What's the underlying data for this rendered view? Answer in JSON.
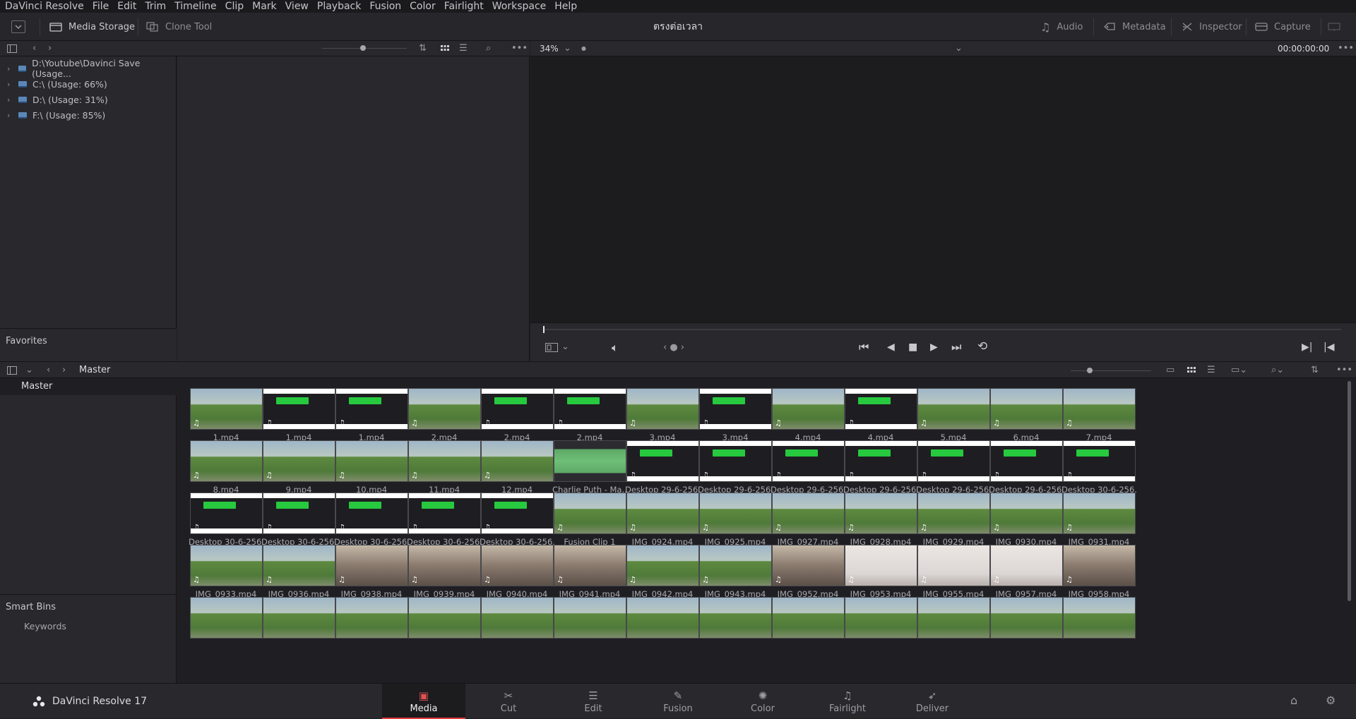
{
  "menu": [
    "DaVinci Resolve",
    "File",
    "Edit",
    "Trim",
    "Timeline",
    "Clip",
    "Mark",
    "View",
    "Playback",
    "Fusion",
    "Color",
    "Fairlight",
    "Workspace",
    "Help"
  ],
  "toolbar": {
    "media_storage": "Media Storage",
    "clone_tool": "Clone Tool",
    "title": "ตรงต่อเวลา",
    "audio": "Audio",
    "metadata": "Metadata",
    "inspector": "Inspector",
    "capture": "Capture"
  },
  "viewer": {
    "zoom": "34%",
    "timecode": "00:00:00:00"
  },
  "storage": {
    "drives": [
      "D:\\Youtube\\Davinci Save (Usage...",
      "C:\\ (Usage: 66%)",
      "D:\\ (Usage: 31%)",
      "F:\\ (Usage: 85%)"
    ],
    "favorites": "Favorites"
  },
  "pool": {
    "breadcrumb": "Master",
    "master": "Master",
    "smart_bins": "Smart Bins",
    "keywords": "Keywords",
    "clips": [
      {
        "name": "1.mp4",
        "kind": "outdoor"
      },
      {
        "name": "1.mp4",
        "kind": "screen"
      },
      {
        "name": "1.mp4",
        "kind": "screen"
      },
      {
        "name": "2.mp4",
        "kind": "outdoor"
      },
      {
        "name": "2.mp4",
        "kind": "screen"
      },
      {
        "name": "2.mp4",
        "kind": "screen"
      },
      {
        "name": "3.mp4",
        "kind": "outdoor"
      },
      {
        "name": "3.mp4",
        "kind": "screen"
      },
      {
        "name": "4.mp4",
        "kind": "outdoor"
      },
      {
        "name": "4.mp4",
        "kind": "screen"
      },
      {
        "name": "5.mp4",
        "kind": "outdoor"
      },
      {
        "name": "6.mp4",
        "kind": "outdoor"
      },
      {
        "name": "7.mp4",
        "kind": "outdoor"
      },
      {
        "name": "8.mp4",
        "kind": "outdoor"
      },
      {
        "name": "9.mp4",
        "kind": "outdoor"
      },
      {
        "name": "10.mp4",
        "kind": "outdoor"
      },
      {
        "name": "11.mp4",
        "kind": "outdoor"
      },
      {
        "name": "12.mp4",
        "kind": "outdoor"
      },
      {
        "name": "Charlie Puth - Ma...",
        "kind": "audio"
      },
      {
        "name": "Desktop 29-6-256...",
        "kind": "screen"
      },
      {
        "name": "Desktop 29-6-256...",
        "kind": "screen"
      },
      {
        "name": "Desktop 29-6-256...",
        "kind": "screen"
      },
      {
        "name": "Desktop 29-6-256...",
        "kind": "screen"
      },
      {
        "name": "Desktop 29-6-256...",
        "kind": "screen"
      },
      {
        "name": "Desktop 29-6-256...",
        "kind": "screen"
      },
      {
        "name": "Desktop 30-6-256...",
        "kind": "screen"
      },
      {
        "name": "Desktop 30-6-256...",
        "kind": "screen"
      },
      {
        "name": "Desktop 30-6-256...",
        "kind": "screen"
      },
      {
        "name": "Desktop 30-6-256...",
        "kind": "screen"
      },
      {
        "name": "Desktop 30-6-256...",
        "kind": "screen"
      },
      {
        "name": "Desktop 30-6-256...",
        "kind": "screen"
      },
      {
        "name": "Fusion Clip 1",
        "kind": "outdoor"
      },
      {
        "name": "IMG_0924.mp4",
        "kind": "outdoor"
      },
      {
        "name": "IMG_0925.mp4",
        "kind": "outdoor"
      },
      {
        "name": "IMG_0927.mp4",
        "kind": "outdoor"
      },
      {
        "name": "IMG_0928.mp4",
        "kind": "outdoor"
      },
      {
        "name": "IMG_0929.mp4",
        "kind": "outdoor"
      },
      {
        "name": "IMG_0930.mp4",
        "kind": "outdoor"
      },
      {
        "name": "IMG_0931.mp4",
        "kind": "outdoor"
      },
      {
        "name": "IMG_0933.mp4",
        "kind": "outdoor"
      },
      {
        "name": "IMG_0936.mp4",
        "kind": "outdoor"
      },
      {
        "name": "IMG_0938.mp4",
        "kind": "indoor"
      },
      {
        "name": "IMG_0939.mp4",
        "kind": "indoor"
      },
      {
        "name": "IMG_0940.mp4",
        "kind": "indoor"
      },
      {
        "name": "IMG_0941.mp4",
        "kind": "indoor"
      },
      {
        "name": "IMG_0942.mp4",
        "kind": "outdoor"
      },
      {
        "name": "IMG_0943.mp4",
        "kind": "outdoor"
      },
      {
        "name": "IMG_0952.mp4",
        "kind": "indoor"
      },
      {
        "name": "IMG_0953.mp4",
        "kind": "wall"
      },
      {
        "name": "IMG_0955.mp4",
        "kind": "wall"
      },
      {
        "name": "IMG_0957.mp4",
        "kind": "wall"
      },
      {
        "name": "IMG_0958.mp4",
        "kind": "indoor"
      }
    ]
  },
  "pages": [
    "Media",
    "Cut",
    "Edit",
    "Fusion",
    "Color",
    "Fairlight",
    "Deliver"
  ],
  "brand": "DaVinci Resolve 17",
  "colors": {
    "accent": "#e23b3b",
    "bg": "#1f1f23",
    "panel": "#28282d"
  }
}
